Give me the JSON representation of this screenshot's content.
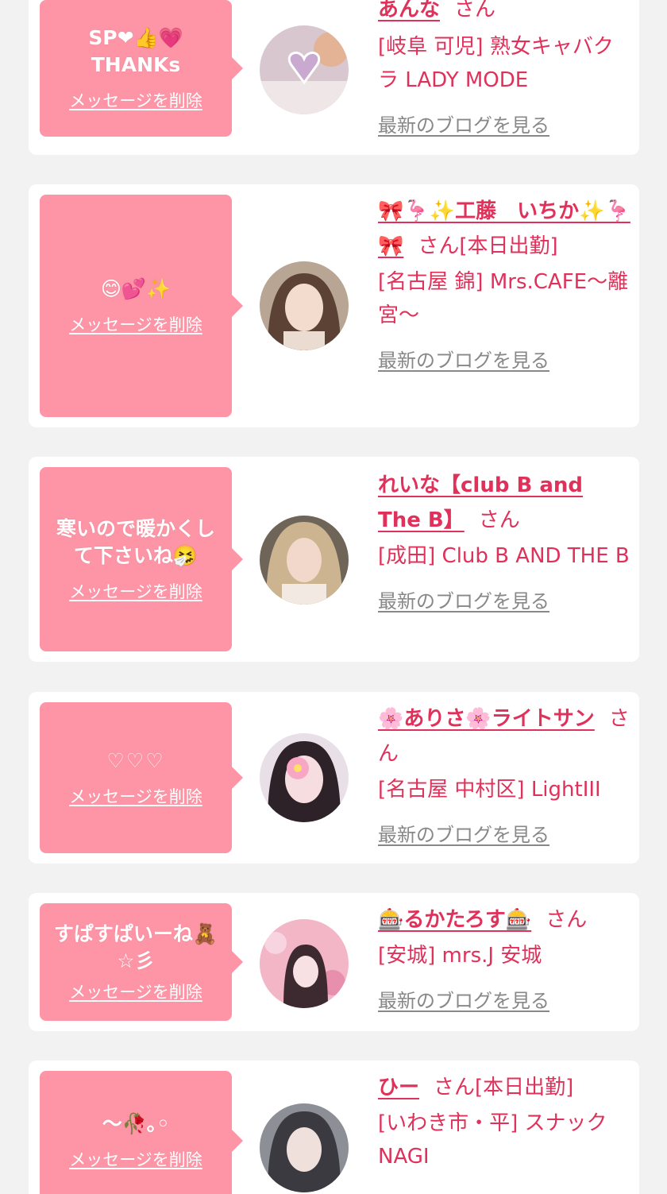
{
  "delete_label": "メッセージを削除",
  "blog_label": "最新のブログを見る",
  "san_label": "さん",
  "accent_color": "#e0315a",
  "bubble_color": "#fd95a6",
  "messages": [
    {
      "bubble_text": "SP❤👍💗 THANKs",
      "name": "あんな",
      "status": "",
      "shop": "[岐阜 可児] 熟女キャバクラ LADY MODE"
    },
    {
      "bubble_text": "😊💕✨",
      "name": "🎀🦩✨工藤　いちか✨🦩🎀",
      "status": "[本日出勤]",
      "shop": "[名古屋 錦] Mrs.CAFE～離宮～"
    },
    {
      "bubble_text": "寒いので暖かくして下さいね🤧",
      "name": "れいな【club B and The B】",
      "status": "",
      "shop": "[成田] Club B AND THE B"
    },
    {
      "bubble_text": "♡♡♡",
      "name": "🌸ありさ🌸ライトサン",
      "status": "",
      "shop": "[名古屋 中村区] LightIII"
    },
    {
      "bubble_text": "すぱすぱいーね🧸 ☆彡",
      "name": "🎰るかたろす🎰",
      "status": "",
      "shop": "[安城] mrs.J 安城"
    },
    {
      "bubble_text": "～🥀｡◦",
      "name": "ひー",
      "status": "[本日出勤]",
      "shop": "[いわき市・平] スナック NAGI"
    }
  ]
}
